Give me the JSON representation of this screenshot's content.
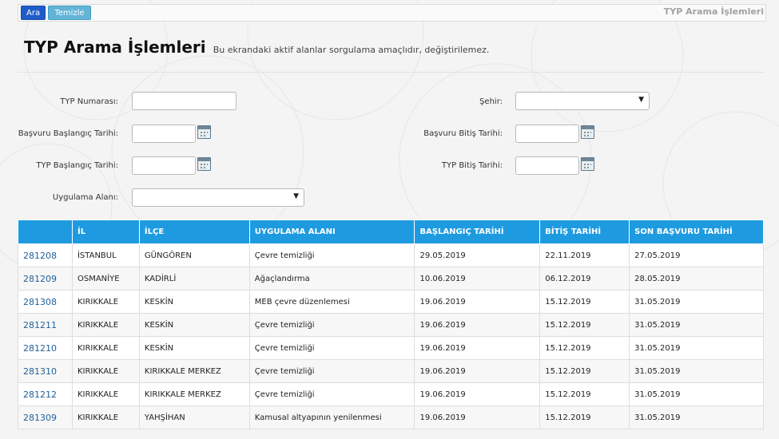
{
  "toolbar": {
    "search_label": "Ara",
    "clear_label": "Temizle",
    "breadcrumb": "TYP Arama İşlemleri"
  },
  "header": {
    "title": "TYP Arama İşlemleri",
    "subtitle": "Bu ekrandaki aktif alanlar sorgulama amaçlıdır, değiştirilemez."
  },
  "form": {
    "typ_number_label": "TYP Numarası:",
    "city_label": "Şehir:",
    "app_start_label": "Başvuru Başlangıç Tarihi:",
    "app_end_label": "Başvuru Bitiş Tarihi:",
    "typ_start_label": "TYP Başlangıç Tarihi:",
    "typ_end_label": "TYP Bitiş Tarihi:",
    "area_label": "Uygulama Alanı:",
    "typ_number_value": "",
    "city_value": "",
    "area_value": "",
    "calendar_icon": "calendar-icon",
    "dropdown_icon": "chevron-down-icon"
  },
  "table": {
    "columns": [
      "",
      "İL",
      "İLÇE",
      "UYGULAMA ALANI",
      "BAŞLANGIÇ TARİHİ",
      "BİTİŞ TARİHİ",
      "SON BAŞVURU TARİHİ"
    ],
    "rows": [
      [
        "281208",
        "İSTANBUL",
        "GÜNGÖREN",
        "Çevre temizliği",
        "29.05.2019",
        "22.11.2019",
        "27.05.2019"
      ],
      [
        "281209",
        "OSMANİYE",
        "KADİRLİ",
        "Ağaçlandırma",
        "10.06.2019",
        "06.12.2019",
        "28.05.2019"
      ],
      [
        "281308",
        "KIRIKKALE",
        "KESKİN",
        "MEB çevre düzenlemesi",
        "19.06.2019",
        "15.12.2019",
        "31.05.2019"
      ],
      [
        "281211",
        "KIRIKKALE",
        "KESKİN",
        "Çevre temizliği",
        "19.06.2019",
        "15.12.2019",
        "31.05.2019"
      ],
      [
        "281210",
        "KIRIKKALE",
        "KESKİN",
        "Çevre temizliği",
        "19.06.2019",
        "15.12.2019",
        "31.05.2019"
      ],
      [
        "281310",
        "KIRIKKALE",
        "KIRIKKALE MERKEZ",
        "Çevre temizliği",
        "19.06.2019",
        "15.12.2019",
        "31.05.2019"
      ],
      [
        "281212",
        "KIRIKKALE",
        "KIRIKKALE MERKEZ",
        "Çevre temizliği",
        "19.06.2019",
        "15.12.2019",
        "31.05.2019"
      ],
      [
        "281309",
        "KIRIKKALE",
        "YAHŞİHAN",
        "Kamusal altyapının yenilenmesi",
        "19.06.2019",
        "15.12.2019",
        "31.05.2019"
      ]
    ]
  },
  "colors": {
    "header_blue": "#1e9be0",
    "search_button": "#1f5cc9",
    "clear_button": "#63b4d6",
    "link": "#1f5f99"
  }
}
